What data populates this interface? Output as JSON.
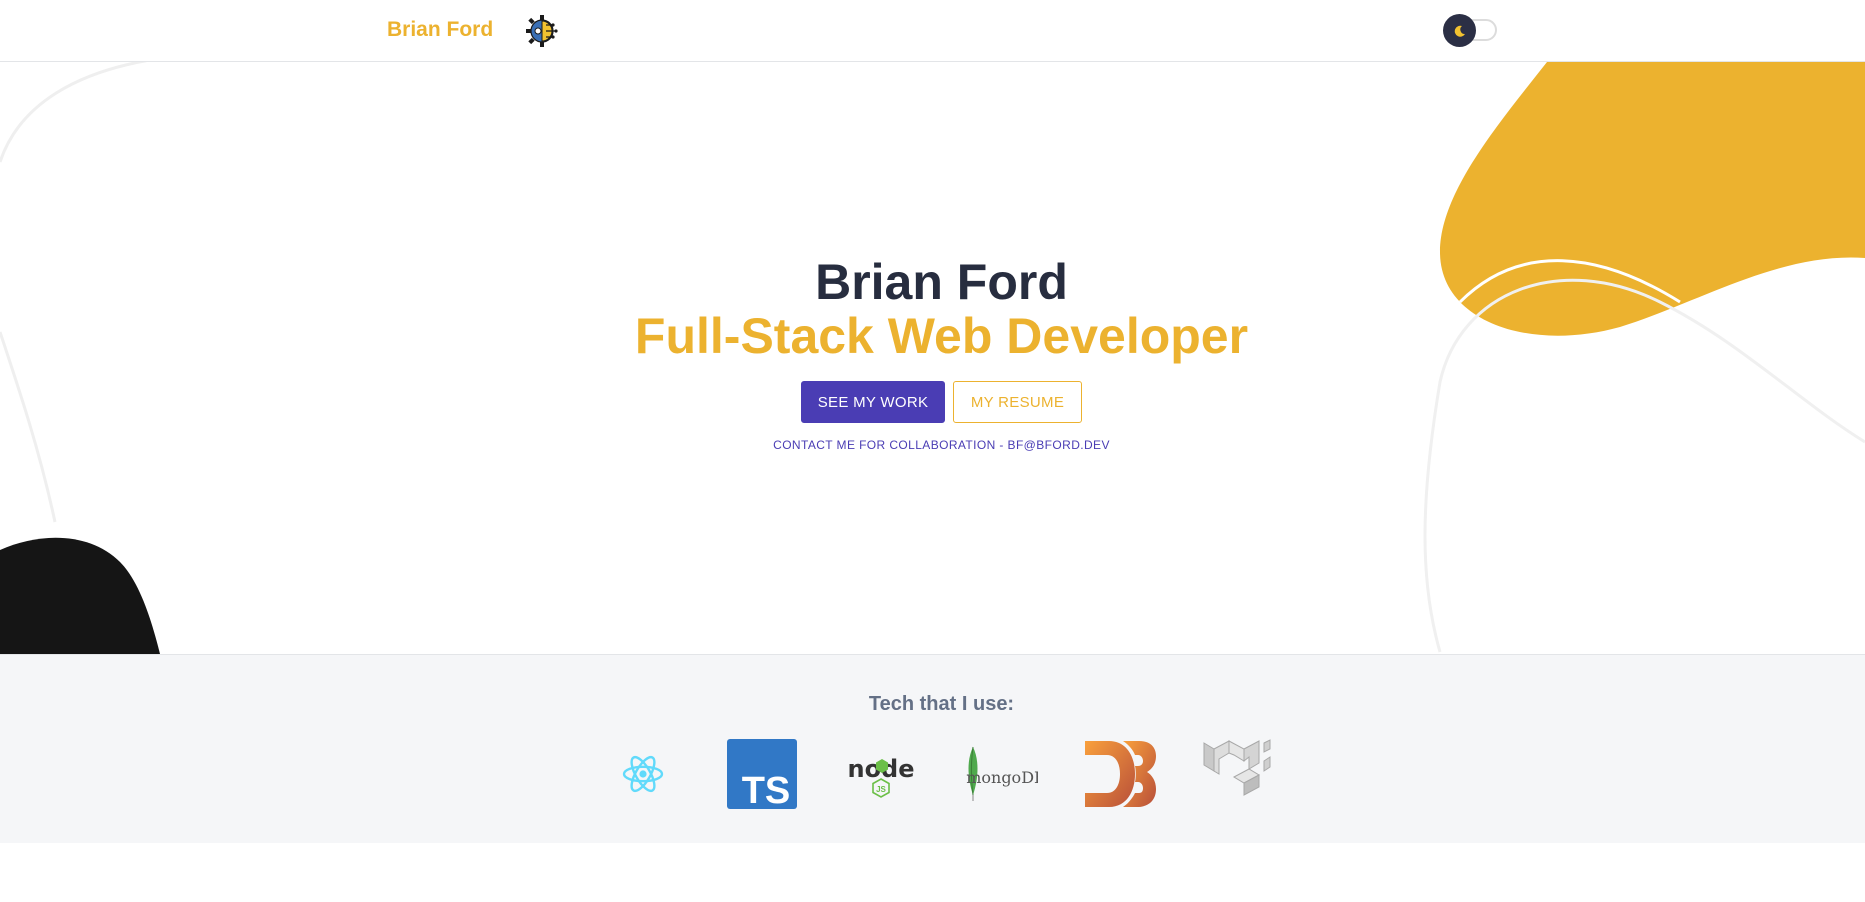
{
  "header": {
    "brand": "Brian Ford",
    "logo_icon": "gear-circuit-icon",
    "theme_toggle_icon": "moon-icon"
  },
  "hero": {
    "name": "Brian Ford",
    "role": "Full-Stack Web Developer",
    "primary_button": "SEE MY WORK",
    "secondary_button": "MY RESUME",
    "contact": "CONTACT ME FOR COLLABORATION - BF@BFORD.DEV"
  },
  "tech": {
    "title": "Tech that I use:",
    "logos": [
      {
        "name": "react-logo-icon"
      },
      {
        "name": "typescript-logo-icon",
        "text": "TS"
      },
      {
        "name": "nodejs-logo-icon",
        "text": "node",
        "sub": "JS"
      },
      {
        "name": "mongodb-logo-icon",
        "text": "mongoDB"
      },
      {
        "name": "d3-logo-icon"
      },
      {
        "name": "material-ui-logo-icon"
      }
    ]
  },
  "colors": {
    "accent_yellow": "#ecb22f",
    "primary_purple": "#4a3db4",
    "heading_dark": "#272d3f",
    "tech_bg": "#f5f6f8",
    "blob_black": "#151515"
  }
}
